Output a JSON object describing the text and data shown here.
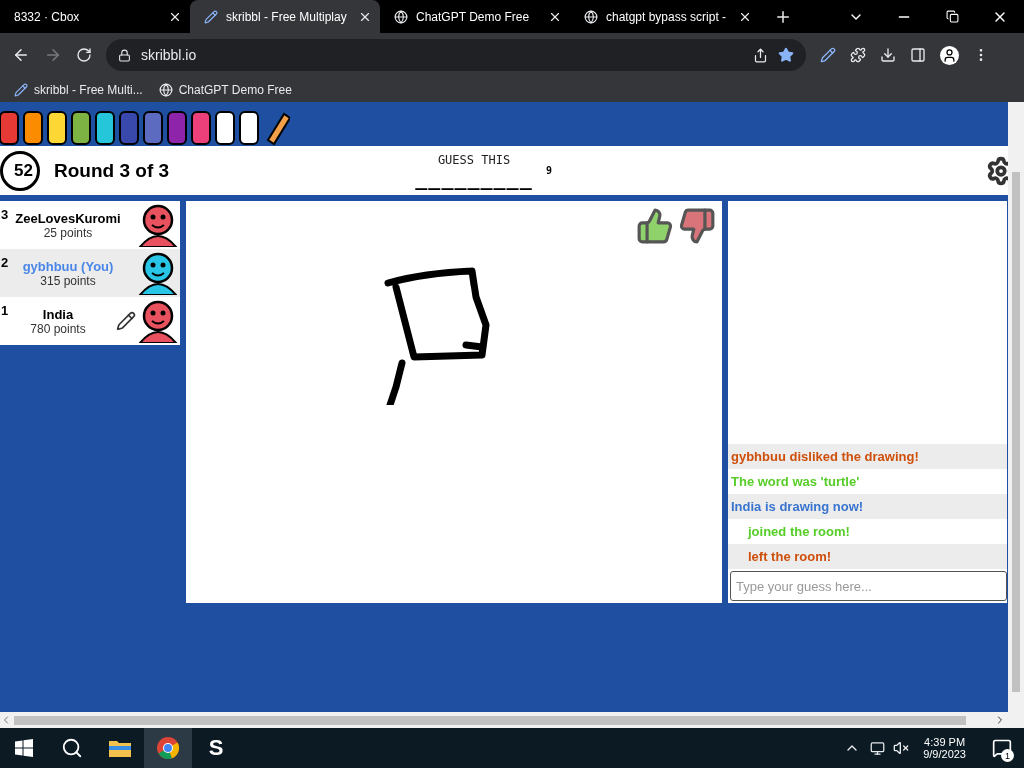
{
  "browser": {
    "tabs": [
      {
        "title": "8332 · Cbox",
        "selected": false,
        "kind": "plain"
      },
      {
        "title": "skribbl - Free Multiplay",
        "selected": true,
        "kind": "pencil"
      },
      {
        "title": "ChatGPT Demo Free",
        "selected": false,
        "kind": "globe"
      },
      {
        "title": "chatgpt bypass script -",
        "selected": false,
        "kind": "globe"
      }
    ],
    "address": "skribbl.io",
    "bookmarks": [
      {
        "title": "skribbl - Free Multi...",
        "kind": "pencil"
      },
      {
        "title": "ChatGPT Demo Free",
        "kind": "globe"
      }
    ]
  },
  "game": {
    "timer": "52",
    "round": "Round 3 of 3",
    "hint_label": "GUESS THIS",
    "word": "_________",
    "word_length": "9",
    "players": [
      {
        "rank": "3",
        "name": "ZeeLovesKuromi",
        "points": "25 points",
        "is_you": false,
        "drawing": false,
        "color": "#e8525e"
      },
      {
        "rank": "2",
        "name": "gybhbuu (You)",
        "points": "315 points",
        "is_you": true,
        "drawing": false,
        "color": "#29c5e6"
      },
      {
        "rank": "1",
        "name": "India",
        "points": "780 points",
        "is_you": false,
        "drawing": true,
        "color": "#e8525e"
      }
    ],
    "chat": {
      "messages": [
        {
          "text": "gybhbuu disliked the drawing!",
          "color": "#ce4f0a",
          "indented": false
        },
        {
          "text": "The word was 'turtle'",
          "color": "#56ce27",
          "indented": false
        },
        {
          "text": "India is drawing now!",
          "color": "#3975ce",
          "indented": false
        },
        {
          "text": "joined the room!",
          "color": "#56ce27",
          "indented": true
        },
        {
          "text": "left the room!",
          "color": "#ce4f0a",
          "indented": true
        }
      ],
      "placeholder": "Type your guess here..."
    }
  },
  "taskbar": {
    "app_label": "S",
    "time": "4:39 PM",
    "date": "9/9/2023",
    "notifications": "1"
  }
}
